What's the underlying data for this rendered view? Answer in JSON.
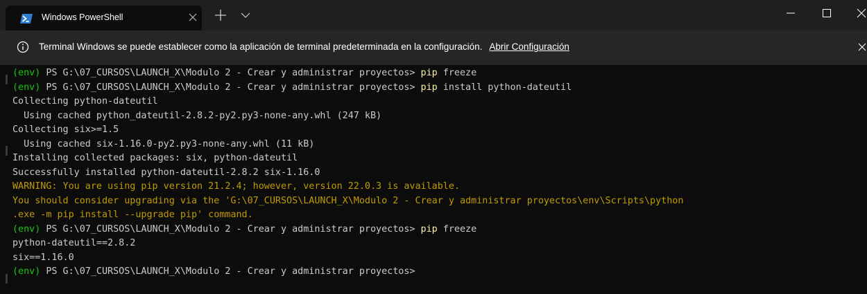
{
  "tab": {
    "title": "Windows PowerShell",
    "icon": "powershell-icon"
  },
  "infobar": {
    "message": "Terminal Windows se puede establecer como la aplicación de terminal predeterminada en la configuración.",
    "link": "Abrir Configuración"
  },
  "colors": {
    "env": "#16c60c",
    "command": "#f9f1a5",
    "warning": "#c19c00",
    "text": "#cccccc"
  },
  "terminal": {
    "prompt_env": "(env)",
    "prompt_path": " PS G:\\07_CURSOS\\LAUNCH_X\\Modulo 2 - Crear y administrar proyectos> ",
    "lines": [
      {
        "type": "prompt",
        "cmd": "pip",
        "args": " freeze"
      },
      {
        "type": "prompt",
        "cmd": "pip",
        "args": " install python-dateutil"
      },
      {
        "type": "text",
        "text": "Collecting python-dateutil"
      },
      {
        "type": "text",
        "text": "  Using cached python_dateutil-2.8.2-py2.py3-none-any.whl (247 kB)"
      },
      {
        "type": "text",
        "text": "Collecting six>=1.5"
      },
      {
        "type": "text",
        "text": "  Using cached six-1.16.0-py2.py3-none-any.whl (11 kB)"
      },
      {
        "type": "text",
        "text": "Installing collected packages: six, python-dateutil"
      },
      {
        "type": "text",
        "text": "Successfully installed python-dateutil-2.8.2 six-1.16.0"
      },
      {
        "type": "warn",
        "text": "WARNING: You are using pip version 21.2.4; however, version 22.0.3 is available."
      },
      {
        "type": "warn",
        "text": "You should consider upgrading via the 'G:\\07_CURSOS\\LAUNCH_X\\Modulo 2 - Crear y administrar proyectos\\env\\Scripts\\python"
      },
      {
        "type": "warn",
        "text": ".exe -m pip install --upgrade pip' command."
      },
      {
        "type": "prompt",
        "cmd": "pip",
        "args": " freeze"
      },
      {
        "type": "text",
        "text": "python-dateutil==2.8.2"
      },
      {
        "type": "text",
        "text": "six==1.16.0"
      },
      {
        "type": "prompt",
        "cmd": "",
        "args": ""
      }
    ]
  }
}
